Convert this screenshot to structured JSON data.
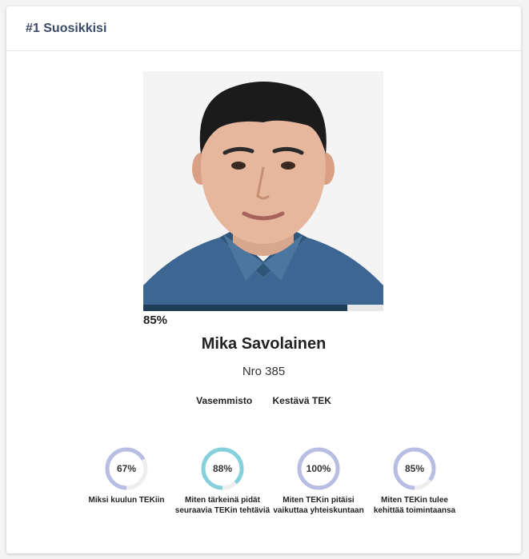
{
  "header": {
    "title": "#1 Suosikkisi"
  },
  "candidate": {
    "match_percent_label": "85%",
    "match_fraction": 0.85,
    "name": "Mika Savolainen",
    "number": "Nro 385",
    "tags": [
      "Vasemmisto",
      "Kestävä TEK"
    ]
  },
  "colors": {
    "title": "#3b4a66",
    "progress_fill": "#1f3d57",
    "gauge_blue": "#b7bde3",
    "gauge_teal": "#86cfdc",
    "gauge_track": "#eeeeee"
  },
  "gauges": [
    {
      "label": "67%",
      "fraction": 0.67,
      "color": "#b7bde3",
      "caption": [
        "Miksi kuulun TEKiin"
      ]
    },
    {
      "label": "88%",
      "fraction": 0.88,
      "color": "#86cfdc",
      "caption": [
        "Miten tärkeinä pidät",
        "seuraavia TEKin tehtäviä"
      ]
    },
    {
      "label": "100%",
      "fraction": 1.0,
      "color": "#b7bde3",
      "caption": [
        "Miten TEKin pitäisi",
        "vaikuttaa yhteiskuntaan"
      ]
    },
    {
      "label": "85%",
      "fraction": 0.85,
      "color": "#b7bde3",
      "caption": [
        "Miten TEKin tulee",
        "kehittää toimintaansa"
      ]
    }
  ]
}
